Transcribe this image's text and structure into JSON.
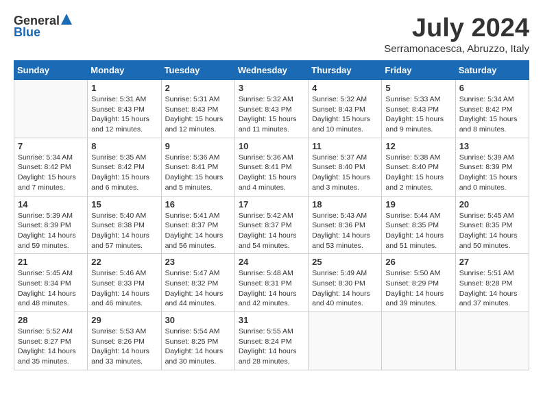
{
  "header": {
    "logo_general": "General",
    "logo_blue": "Blue",
    "month_title": "July 2024",
    "subtitle": "Serramonacesca, Abruzzo, Italy"
  },
  "weekdays": [
    "Sunday",
    "Monday",
    "Tuesday",
    "Wednesday",
    "Thursday",
    "Friday",
    "Saturday"
  ],
  "weeks": [
    [
      {
        "day": "",
        "info": ""
      },
      {
        "day": "1",
        "info": "Sunrise: 5:31 AM\nSunset: 8:43 PM\nDaylight: 15 hours\nand 12 minutes."
      },
      {
        "day": "2",
        "info": "Sunrise: 5:31 AM\nSunset: 8:43 PM\nDaylight: 15 hours\nand 12 minutes."
      },
      {
        "day": "3",
        "info": "Sunrise: 5:32 AM\nSunset: 8:43 PM\nDaylight: 15 hours\nand 11 minutes."
      },
      {
        "day": "4",
        "info": "Sunrise: 5:32 AM\nSunset: 8:43 PM\nDaylight: 15 hours\nand 10 minutes."
      },
      {
        "day": "5",
        "info": "Sunrise: 5:33 AM\nSunset: 8:43 PM\nDaylight: 15 hours\nand 9 minutes."
      },
      {
        "day": "6",
        "info": "Sunrise: 5:34 AM\nSunset: 8:42 PM\nDaylight: 15 hours\nand 8 minutes."
      }
    ],
    [
      {
        "day": "7",
        "info": "Sunrise: 5:34 AM\nSunset: 8:42 PM\nDaylight: 15 hours\nand 7 minutes."
      },
      {
        "day": "8",
        "info": "Sunrise: 5:35 AM\nSunset: 8:42 PM\nDaylight: 15 hours\nand 6 minutes."
      },
      {
        "day": "9",
        "info": "Sunrise: 5:36 AM\nSunset: 8:41 PM\nDaylight: 15 hours\nand 5 minutes."
      },
      {
        "day": "10",
        "info": "Sunrise: 5:36 AM\nSunset: 8:41 PM\nDaylight: 15 hours\nand 4 minutes."
      },
      {
        "day": "11",
        "info": "Sunrise: 5:37 AM\nSunset: 8:40 PM\nDaylight: 15 hours\nand 3 minutes."
      },
      {
        "day": "12",
        "info": "Sunrise: 5:38 AM\nSunset: 8:40 PM\nDaylight: 15 hours\nand 2 minutes."
      },
      {
        "day": "13",
        "info": "Sunrise: 5:39 AM\nSunset: 8:39 PM\nDaylight: 15 hours\nand 0 minutes."
      }
    ],
    [
      {
        "day": "14",
        "info": "Sunrise: 5:39 AM\nSunset: 8:39 PM\nDaylight: 14 hours\nand 59 minutes."
      },
      {
        "day": "15",
        "info": "Sunrise: 5:40 AM\nSunset: 8:38 PM\nDaylight: 14 hours\nand 57 minutes."
      },
      {
        "day": "16",
        "info": "Sunrise: 5:41 AM\nSunset: 8:37 PM\nDaylight: 14 hours\nand 56 minutes."
      },
      {
        "day": "17",
        "info": "Sunrise: 5:42 AM\nSunset: 8:37 PM\nDaylight: 14 hours\nand 54 minutes."
      },
      {
        "day": "18",
        "info": "Sunrise: 5:43 AM\nSunset: 8:36 PM\nDaylight: 14 hours\nand 53 minutes."
      },
      {
        "day": "19",
        "info": "Sunrise: 5:44 AM\nSunset: 8:35 PM\nDaylight: 14 hours\nand 51 minutes."
      },
      {
        "day": "20",
        "info": "Sunrise: 5:45 AM\nSunset: 8:35 PM\nDaylight: 14 hours\nand 50 minutes."
      }
    ],
    [
      {
        "day": "21",
        "info": "Sunrise: 5:45 AM\nSunset: 8:34 PM\nDaylight: 14 hours\nand 48 minutes."
      },
      {
        "day": "22",
        "info": "Sunrise: 5:46 AM\nSunset: 8:33 PM\nDaylight: 14 hours\nand 46 minutes."
      },
      {
        "day": "23",
        "info": "Sunrise: 5:47 AM\nSunset: 8:32 PM\nDaylight: 14 hours\nand 44 minutes."
      },
      {
        "day": "24",
        "info": "Sunrise: 5:48 AM\nSunset: 8:31 PM\nDaylight: 14 hours\nand 42 minutes."
      },
      {
        "day": "25",
        "info": "Sunrise: 5:49 AM\nSunset: 8:30 PM\nDaylight: 14 hours\nand 40 minutes."
      },
      {
        "day": "26",
        "info": "Sunrise: 5:50 AM\nSunset: 8:29 PM\nDaylight: 14 hours\nand 39 minutes."
      },
      {
        "day": "27",
        "info": "Sunrise: 5:51 AM\nSunset: 8:28 PM\nDaylight: 14 hours\nand 37 minutes."
      }
    ],
    [
      {
        "day": "28",
        "info": "Sunrise: 5:52 AM\nSunset: 8:27 PM\nDaylight: 14 hours\nand 35 minutes."
      },
      {
        "day": "29",
        "info": "Sunrise: 5:53 AM\nSunset: 8:26 PM\nDaylight: 14 hours\nand 33 minutes."
      },
      {
        "day": "30",
        "info": "Sunrise: 5:54 AM\nSunset: 8:25 PM\nDaylight: 14 hours\nand 30 minutes."
      },
      {
        "day": "31",
        "info": "Sunrise: 5:55 AM\nSunset: 8:24 PM\nDaylight: 14 hours\nand 28 minutes."
      },
      {
        "day": "",
        "info": ""
      },
      {
        "day": "",
        "info": ""
      },
      {
        "day": "",
        "info": ""
      }
    ]
  ]
}
